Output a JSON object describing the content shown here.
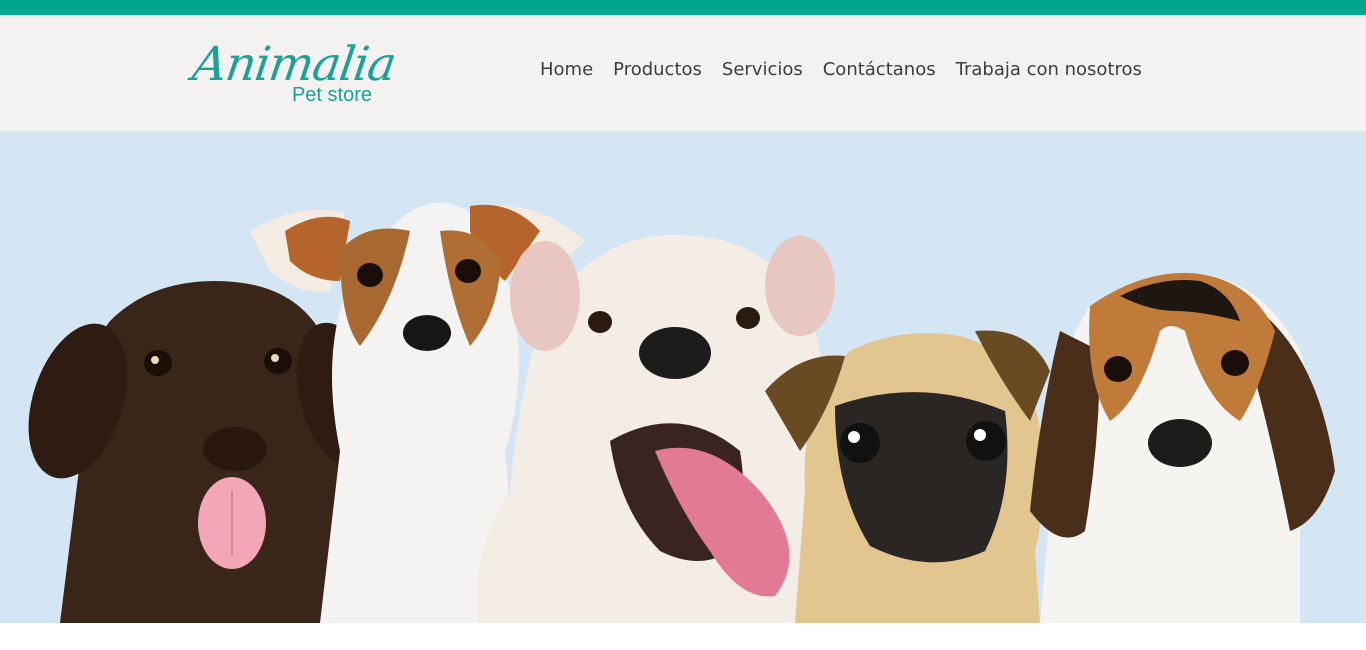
{
  "brand": {
    "name": "Animalia",
    "subtitle": "Pet store",
    "color": "#1aa394"
  },
  "nav": {
    "items": [
      {
        "label": "Home"
      },
      {
        "label": "Productos"
      },
      {
        "label": "Servicios"
      },
      {
        "label": "Contáctanos"
      },
      {
        "label": "Trabaja con nosotros"
      }
    ]
  },
  "colors": {
    "topbar": "#00a68e",
    "header_bg": "#f3f2f0",
    "hero_bg": "#d4e5f4",
    "nav_text": "#3d3d3d"
  },
  "hero": {
    "image_subject": "five puppies portrait"
  }
}
